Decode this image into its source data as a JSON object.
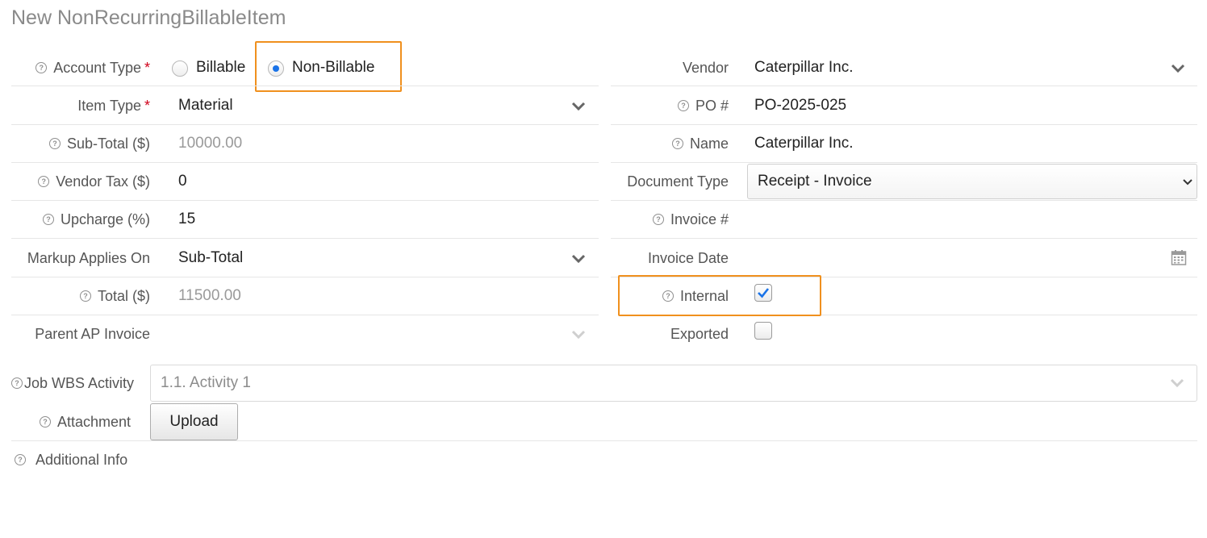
{
  "page": {
    "title": "New NonRecurringBillableItem"
  },
  "left": {
    "account_type": {
      "label": "Account Type",
      "required_mark": "*",
      "options": [
        "Billable",
        "Non-Billable"
      ],
      "selected": "Non-Billable"
    },
    "item_type": {
      "label": "Item Type",
      "required_mark": "*",
      "value": "Material"
    },
    "sub_total": {
      "label": "Sub-Total ($)",
      "value": "10000.00"
    },
    "vendor_tax": {
      "label": "Vendor Tax ($)",
      "value": "0"
    },
    "upcharge": {
      "label": "Upcharge (%)",
      "value": "15"
    },
    "markup_applies_on": {
      "label": "Markup Applies On",
      "value": "Sub-Total"
    },
    "total": {
      "label": "Total ($)",
      "value": "11500.00"
    },
    "parent_ap_invoice": {
      "label": "Parent AP Invoice",
      "value": ""
    }
  },
  "right": {
    "vendor": {
      "label": "Vendor",
      "value": "Caterpillar Inc."
    },
    "po_number": {
      "label": "PO #",
      "value": "PO-2025-025"
    },
    "name": {
      "label": "Name",
      "value": "Caterpillar Inc."
    },
    "document_type": {
      "label": "Document Type",
      "value": "Receipt - Invoice"
    },
    "invoice_number": {
      "label": "Invoice #",
      "value": ""
    },
    "invoice_date": {
      "label": "Invoice Date",
      "value": ""
    },
    "internal": {
      "label": "Internal",
      "checked": true
    },
    "exported": {
      "label": "Exported",
      "checked": false
    }
  },
  "bottom": {
    "job_wbs_activity": {
      "label": "Job WBS Activity",
      "value": "1.1. Activity 1"
    },
    "attachment": {
      "label": "Attachment",
      "button_label": "Upload"
    },
    "additional_info": {
      "label": "Additional Info"
    }
  },
  "icons": {
    "help": "question-circle-icon",
    "chevron": "chevron-down-icon",
    "calendar": "calendar-icon",
    "check": "checkmark-icon"
  },
  "colors": {
    "highlight": "#f0901e",
    "radio_selected": "#1a73e8",
    "required": "#d0021b",
    "check": "#1a73e8"
  }
}
